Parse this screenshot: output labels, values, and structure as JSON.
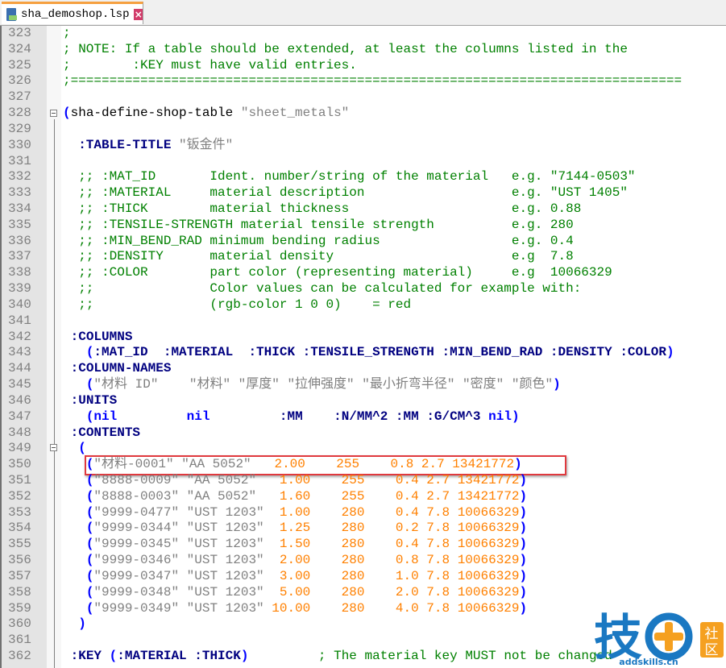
{
  "tab": {
    "filename": "sha_demoshop.lsp",
    "icons": [
      "save-icon",
      "close-icon"
    ],
    "close_glyph": "×"
  },
  "colors": {
    "comment": "#008000",
    "keyword": "#000080",
    "string": "#808080",
    "number": "#ff8000",
    "paren": "#0000ff",
    "highlight_box": "#e0393e"
  },
  "highlighted_line": 350,
  "fold_markers": [
    328,
    349
  ],
  "lines": [
    {
      "n": "323",
      "t": [
        [
          "c",
          ";"
        ]
      ]
    },
    {
      "n": "324",
      "t": [
        [
          "c",
          "; NOTE: If a table should be extended, at least the columns listed in the"
        ]
      ]
    },
    {
      "n": "325",
      "t": [
        [
          "c",
          ";        :KEY must have valid entries."
        ]
      ]
    },
    {
      "n": "326",
      "t": [
        [
          "c",
          ";==============================================================================="
        ]
      ]
    },
    {
      "n": "327",
      "t": []
    },
    {
      "n": "328",
      "t": [
        [
          "p",
          "("
        ],
        [
          "x",
          "sha-define-shop-table "
        ],
        [
          "s",
          "\"sheet_metals\""
        ]
      ]
    },
    {
      "n": "329",
      "t": []
    },
    {
      "n": "330",
      "t": [
        [
          "x",
          "  "
        ],
        [
          "k",
          ":TABLE-TITLE "
        ],
        [
          "s",
          "\"钣金件\""
        ]
      ]
    },
    {
      "n": "331",
      "t": []
    },
    {
      "n": "332",
      "t": [
        [
          "c",
          "  ;; :MAT_ID       Ident. number/string of the material   e.g. \"7144-0503\""
        ]
      ]
    },
    {
      "n": "333",
      "t": [
        [
          "c",
          "  ;; :MATERIAL     material description                   e.g. \"UST 1405\""
        ]
      ]
    },
    {
      "n": "334",
      "t": [
        [
          "c",
          "  ;; :THICK        material thickness                     e.g. 0.88"
        ]
      ]
    },
    {
      "n": "335",
      "t": [
        [
          "c",
          "  ;; :TENSILE-STRENGTH material tensile strength          e.g. 280"
        ]
      ]
    },
    {
      "n": "336",
      "t": [
        [
          "c",
          "  ;; :MIN_BEND_RAD minimum bending radius                 e.g. 0.4"
        ]
      ]
    },
    {
      "n": "337",
      "t": [
        [
          "c",
          "  ;; :DENSITY      material density                       e.g  7.8"
        ]
      ]
    },
    {
      "n": "338",
      "t": [
        [
          "c",
          "  ;; :COLOR        part color (representing material)     e.g  10066329"
        ]
      ]
    },
    {
      "n": "339",
      "t": [
        [
          "c",
          "  ;;               Color values can be calculated for example with:"
        ]
      ]
    },
    {
      "n": "340",
      "t": [
        [
          "c",
          "  ;;               (rgb-color 1 0 0)    = red"
        ]
      ]
    },
    {
      "n": "341",
      "t": []
    },
    {
      "n": "342",
      "t": [
        [
          "x",
          " "
        ],
        [
          "k",
          ":COLUMNS"
        ]
      ]
    },
    {
      "n": "343",
      "t": [
        [
          "x",
          "   "
        ],
        [
          "p",
          "("
        ],
        [
          "k",
          ":MAT_ID  :MATERIAL  :THICK :TENSILE_STRENGTH :MIN_BEND_RAD :DENSITY :COLOR"
        ],
        [
          "p",
          ")"
        ]
      ]
    },
    {
      "n": "344",
      "t": [
        [
          "x",
          " "
        ],
        [
          "k",
          ":COLUMN-NAMES"
        ]
      ]
    },
    {
      "n": "345",
      "t": [
        [
          "x",
          "   "
        ],
        [
          "p",
          "("
        ],
        [
          "s",
          "\"材料 ID\"    \"材料\" \"厚度\" \"拉伸强度\" \"最小折弯半径\" \"密度\" \"颜色\""
        ],
        [
          "p",
          ")"
        ]
      ]
    },
    {
      "n": "346",
      "t": [
        [
          "x",
          " "
        ],
        [
          "k",
          ":UNITS"
        ]
      ]
    },
    {
      "n": "347",
      "t": [
        [
          "x",
          "   "
        ],
        [
          "p",
          "("
        ],
        [
          "p",
          "nil"
        ],
        [
          "k",
          "         "
        ],
        [
          "p",
          "nil"
        ],
        [
          "k",
          "         :MM    :N/MM^2 :MM :G/CM^3 "
        ],
        [
          "p",
          "nil"
        ],
        [
          "p",
          ")"
        ]
      ]
    },
    {
      "n": "348",
      "t": [
        [
          "x",
          " "
        ],
        [
          "k",
          ":CONTENTS"
        ]
      ]
    },
    {
      "n": "349",
      "t": [
        [
          "x",
          "  "
        ],
        [
          "p",
          "("
        ]
      ]
    },
    {
      "n": "350",
      "t": [
        [
          "x",
          "   "
        ],
        [
          "p",
          "("
        ],
        [
          "s",
          "\"材料-0001\" \"AA 5052\""
        ],
        [
          "n",
          "   2.00    255    0.8 2.7 13421772"
        ],
        [
          "p",
          ")"
        ]
      ]
    },
    {
      "n": "351",
      "t": [
        [
          "x",
          "   "
        ],
        [
          "p",
          "("
        ],
        [
          "s",
          "\"8888-0009\" \"AA 5052\""
        ],
        [
          "n",
          "   1.00    255    0.4 2.7 13421772"
        ],
        [
          "p",
          ")"
        ]
      ]
    },
    {
      "n": "352",
      "t": [
        [
          "x",
          "   "
        ],
        [
          "p",
          "("
        ],
        [
          "s",
          "\"8888-0003\" \"AA 5052\""
        ],
        [
          "n",
          "   1.60    255    0.4 2.7 13421772"
        ],
        [
          "p",
          ")"
        ]
      ]
    },
    {
      "n": "353",
      "t": [
        [
          "x",
          "   "
        ],
        [
          "p",
          "("
        ],
        [
          "s",
          "\"9999-0477\" \"UST 1203\""
        ],
        [
          "n",
          "  1.00    280    0.4 7.8 10066329"
        ],
        [
          "p",
          ")"
        ]
      ]
    },
    {
      "n": "354",
      "t": [
        [
          "x",
          "   "
        ],
        [
          "p",
          "("
        ],
        [
          "s",
          "\"9999-0344\" \"UST 1203\""
        ],
        [
          "n",
          "  1.25    280    0.2 7.8 10066329"
        ],
        [
          "p",
          ")"
        ]
      ]
    },
    {
      "n": "355",
      "t": [
        [
          "x",
          "   "
        ],
        [
          "p",
          "("
        ],
        [
          "s",
          "\"9999-0345\" \"UST 1203\""
        ],
        [
          "n",
          "  1.50    280    0.4 7.8 10066329"
        ],
        [
          "p",
          ")"
        ]
      ]
    },
    {
      "n": "356",
      "t": [
        [
          "x",
          "   "
        ],
        [
          "p",
          "("
        ],
        [
          "s",
          "\"9999-0346\" \"UST 1203\""
        ],
        [
          "n",
          "  2.00    280    0.8 7.8 10066329"
        ],
        [
          "p",
          ")"
        ]
      ]
    },
    {
      "n": "357",
      "t": [
        [
          "x",
          "   "
        ],
        [
          "p",
          "("
        ],
        [
          "s",
          "\"9999-0347\" \"UST 1203\""
        ],
        [
          "n",
          "  3.00    280    1.0 7.8 10066329"
        ],
        [
          "p",
          ")"
        ]
      ]
    },
    {
      "n": "358",
      "t": [
        [
          "x",
          "   "
        ],
        [
          "p",
          "("
        ],
        [
          "s",
          "\"9999-0348\" \"UST 1203\""
        ],
        [
          "n",
          "  5.00    280    2.0 7.8 10066329"
        ],
        [
          "p",
          ")"
        ]
      ]
    },
    {
      "n": "359",
      "t": [
        [
          "x",
          "   "
        ],
        [
          "p",
          "("
        ],
        [
          "s",
          "\"9999-0349\" \"UST 1203\""
        ],
        [
          "n",
          " 10.00    280    4.0 7.8 10066329"
        ],
        [
          "p",
          ")"
        ]
      ]
    },
    {
      "n": "360",
      "t": [
        [
          "x",
          "  "
        ],
        [
          "p",
          ")"
        ]
      ]
    },
    {
      "n": "361",
      "t": []
    },
    {
      "n": "362",
      "t": [
        [
          "x",
          " "
        ],
        [
          "k",
          ":KEY "
        ],
        [
          "p",
          "("
        ],
        [
          "k",
          ":MATERIAL :THICK"
        ],
        [
          "p",
          ")"
        ],
        [
          "x",
          "         "
        ],
        [
          "c",
          "; The material key MUST not be changed"
        ]
      ]
    }
  ],
  "watermark": {
    "logo_text": "技+社区",
    "url": "addskills.cn",
    "color_blue": "#1a78c2",
    "color_orange": "#f5a020"
  }
}
